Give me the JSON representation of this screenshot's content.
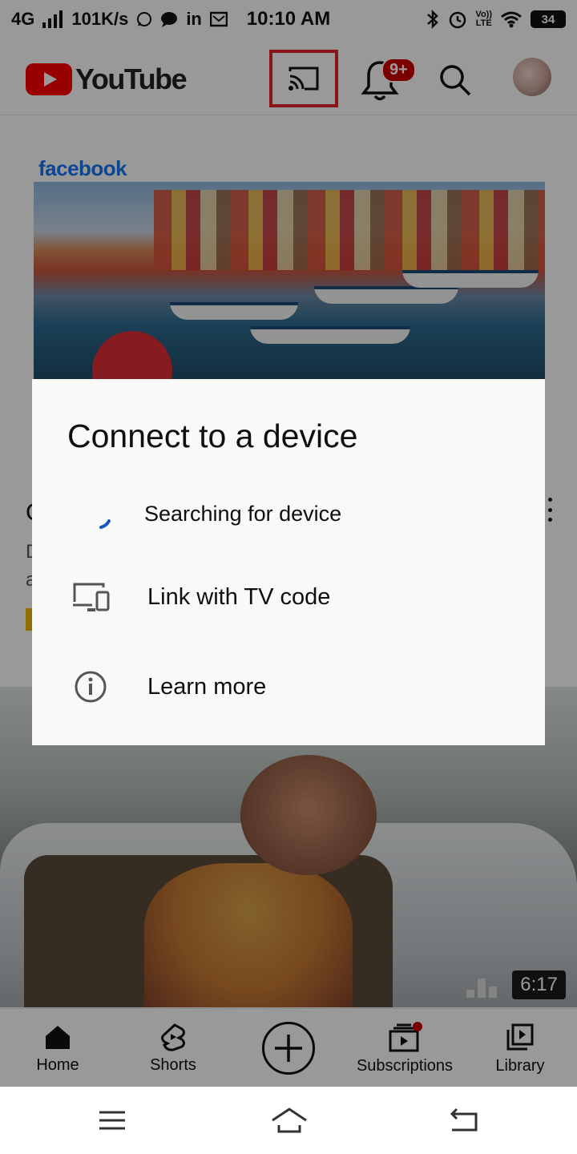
{
  "status_bar": {
    "network": "4G",
    "speed": "101K/s",
    "time": "10:10 AM",
    "volte_top": "Vo))",
    "volte_bottom": "LTE",
    "battery": "34"
  },
  "header": {
    "logo_text": "YouTube",
    "notification_badge": "9+",
    "cast_highlight_color": "#e3262c",
    "brand_red": "#ff0000"
  },
  "feed": {
    "ad_brand": "facebook",
    "video_duration": "6:17"
  },
  "dialog": {
    "title": "Connect to a device",
    "items": [
      {
        "label": "Searching for device",
        "icon": "spinner-icon"
      },
      {
        "label": "Link with TV code",
        "icon": "tv-device-icon"
      },
      {
        "label": "Learn more",
        "icon": "info-icon"
      }
    ]
  },
  "bottom_nav": {
    "items": [
      {
        "label": "Home",
        "icon": "home-icon"
      },
      {
        "label": "Shorts",
        "icon": "shorts-icon"
      },
      {
        "label": "",
        "icon": "create-icon"
      },
      {
        "label": "Subscriptions",
        "icon": "subscriptions-icon"
      },
      {
        "label": "Library",
        "icon": "library-icon"
      }
    ]
  },
  "system_nav": [
    "menu-icon",
    "home-icon",
    "back-icon"
  ]
}
